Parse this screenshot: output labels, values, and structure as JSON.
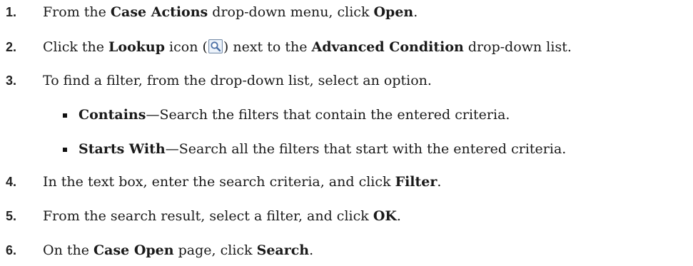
{
  "steps": [
    {
      "number": "1.",
      "parts": [
        "From the ",
        "Case Actions",
        " drop-down menu, click ",
        "Open",
        "."
      ]
    },
    {
      "number": "2.",
      "parts": [
        "Click the ",
        "Lookup",
        " icon (",
        ") next to the ",
        "Advanced Condition",
        " drop-down list."
      ],
      "icon": "lookup-magnifier-icon"
    },
    {
      "number": "3.",
      "parts": [
        "To find a filter, from the drop-down list, select an option."
      ]
    },
    {
      "number": "4.",
      "parts": [
        "In the text box, enter the search criteria, and click ",
        "Filter",
        "."
      ]
    },
    {
      "number": "5.",
      "parts": [
        "From the search result, select a filter, and click ",
        "OK",
        "."
      ]
    },
    {
      "number": "6.",
      "parts": [
        "On the ",
        "Case Open",
        " page, click ",
        "Search",
        "."
      ]
    }
  ],
  "options": [
    {
      "term": "Contains",
      "description": "—Search the filters that contain the entered criteria."
    },
    {
      "term": "Starts With",
      "description": "—Search all the filters that start with the entered criteria."
    }
  ],
  "colors": {
    "text": "#1a1a1a",
    "number": "#222222",
    "icon_border": "#7a8ea8",
    "icon_fill": "#dce8f6",
    "lens": "#4a6fa5"
  }
}
